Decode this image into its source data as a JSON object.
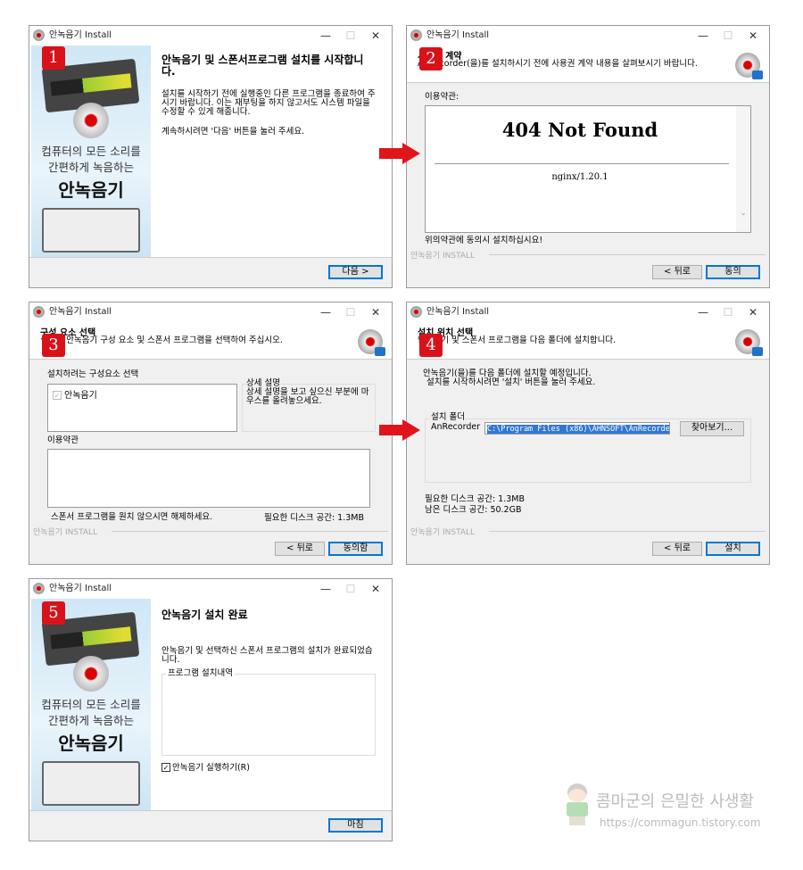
{
  "window_title": "안녹음기 Install",
  "brand_footer": "안녹음기 INSTALL",
  "controls": {
    "minimize": "—",
    "maximize": "☐",
    "close": "✕"
  },
  "banner": {
    "line1": "컴퓨터의 모든 소리를",
    "line2": "간편하게 녹음하는",
    "logo": "안녹음기"
  },
  "step1": {
    "badge": "1",
    "title": "안녹음기 및 스폰서프로그램 설치를 시작합니다.",
    "body": "설치를 시작하기 전에 실행중인 다른 프로그램을 종료하여 주시기 바랍니다. 이는 재부팅을 하지 않고서도 시스템 파일을 수정할 수 있게 해줍니다.",
    "hint": "계속하시려면 '다음' 버튼을 눌러 주세요.",
    "next": "다음 >"
  },
  "step2": {
    "badge": "2",
    "title": "사용권 계약",
    "subtitle": "AnRecorder(을)를 설치하시기 전에 사용권 계약 내용을 살펴보시기 바랍니다.",
    "label": "이용약관:",
    "error_title": "404 Not Found",
    "server": "nginx/1.20.1",
    "agree_note": "위의약관에 동의시 설치하십시요!",
    "back": "< 뒤로",
    "agree": "동의"
  },
  "step3": {
    "badge": "3",
    "title": "구성 요소 선택",
    "subtitle": "설치할 안녹음기 구성 요소 및 스폰서 프로그램을 선택하여 주십시오.",
    "select_label": "설치하려는 구성요소 선택",
    "component": "안녹음기",
    "desc_title": "상세 설명",
    "desc": "상세 설명을 보고 싶으신 부분에 마우스를 올려놓으세요.",
    "terms_label": "이용약관",
    "sponsor_note": "스폰서 프로그램을 원치 않으시면 해제하세요.",
    "disk_required": "필요한 디스크 공간: 1.3MB",
    "back": "< 뒤로",
    "agree": "동의함"
  },
  "step4": {
    "badge": "4",
    "title": "설치 위치 선택",
    "subtitle": "안녹음기 및 스폰서 프로그램을 다음 폴더에 설치합니다.",
    "body1": "안녹음기(을)를 다음 폴더에 설치할 예정입니다.",
    "body2": "설치를 시작하시려면 '설치' 버튼을 눌러 주세요.",
    "folder_group": "설치 폴더",
    "folder_name": "AnRecorder",
    "path": "C:\\Program Files (x86)\\AHNSOFT\\AnRecorder",
    "browse": "찾아보기...",
    "disk_required": "필요한 디스크 공간: 1.3MB",
    "disk_free": "남은 디스크 공간: 50.2GB",
    "back": "< 뒤로",
    "install": "설치"
  },
  "step5": {
    "badge": "5",
    "title": "안녹음기 설치 완료",
    "body": "안녹음기 및 선택하신 스폰서 프로그램의 설치가 완료되었습니다.",
    "group": "프로그램 설치내역",
    "run_label": "안녹음기 실행하기(R)",
    "run_checked": true,
    "finish": "마침"
  },
  "watermark": {
    "title": "콤마군의 은밀한 사생활",
    "url": "https://commagun.tistory.com"
  },
  "colors": {
    "badge": "#d9121a",
    "arrow": "#e0141b",
    "default_button_border": "#0078d7"
  }
}
